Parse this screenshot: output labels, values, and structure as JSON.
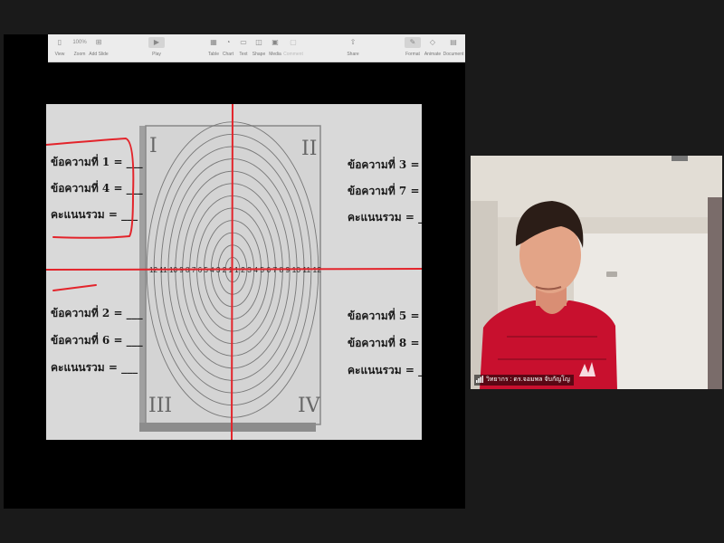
{
  "toolbar": {
    "items": [
      {
        "label": "View",
        "icon": "sidebar-icon"
      },
      {
        "label": "Zoom",
        "icon": "zoom-select",
        "value": "100%"
      },
      {
        "label": "Add Slide",
        "icon": "add-slide-icon"
      },
      {
        "label": "Play",
        "icon": "play-icon"
      },
      {
        "label": "Table",
        "icon": "table-icon"
      },
      {
        "label": "Chart",
        "icon": "chart-icon"
      },
      {
        "label": "Text",
        "icon": "text-icon"
      },
      {
        "label": "Shape",
        "icon": "shape-icon"
      },
      {
        "label": "Media",
        "icon": "media-icon"
      },
      {
        "label": "Comment",
        "icon": "comment-icon"
      },
      {
        "label": "Share",
        "icon": "share-icon"
      },
      {
        "label": "Format",
        "icon": "format-icon"
      },
      {
        "label": "Animate",
        "icon": "animate-icon"
      },
      {
        "label": "Document",
        "icon": "document-icon"
      }
    ]
  },
  "slide": {
    "quadrants": [
      "I",
      "II",
      "III",
      "IV"
    ],
    "left_top": [
      "ข้อความที่ 1 = ___",
      "ข้อความที่ 4 = ___",
      "คะแนนรวม = ___"
    ],
    "right_top": [
      "ข้อความที่ 3 = ___",
      "ข้อความที่ 7 = ___",
      "คะแนนรวม = ___"
    ],
    "left_bottom": [
      "ข้อความที่ 2 = ___",
      "ข้อความที่ 6 = ___",
      "คะแนนรวม = ___"
    ],
    "right_bottom": [
      "ข้อความที่ 5 = ___",
      "ข้อความที่ 8 = ___",
      "คะแนนรวม = ___"
    ],
    "axis_left": "12 11 10 9 8 7 6 5 4 3 2 1",
    "axis_right": "1 2 3 4 5 6 7 8 9 10 11 12"
  },
  "participant": {
    "name": "วิทยากร : ดร.จอมพล จับกัญโญ"
  },
  "colors": {
    "annotation": "#e3242b",
    "shirt": "#c8102e",
    "background": "#1a1a1a"
  }
}
